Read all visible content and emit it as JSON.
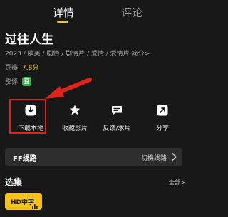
{
  "tabs": {
    "details": "详情",
    "comments": "评论"
  },
  "title": "过往人生",
  "meta": "2023 / 欧美 / 剧情 / 剧情片 / 爱情 / 爱情片·简介>",
  "score": {
    "label": "豆瓣:",
    "value": "7.8分"
  },
  "review": {
    "label": "影评:",
    "badge": "豆"
  },
  "actions": {
    "download": "下载本地",
    "favorite": "收藏影片",
    "feedback": "反馈/求片",
    "share": "分享"
  },
  "line": {
    "name": "FF线路",
    "switch": "切换线路"
  },
  "episodes": {
    "title": "选集",
    "all": "全部>",
    "chip": "HD中字"
  },
  "colors": {
    "accent": "#f4c21b",
    "highlight": "#e2231a",
    "douban": "#3db14c"
  }
}
